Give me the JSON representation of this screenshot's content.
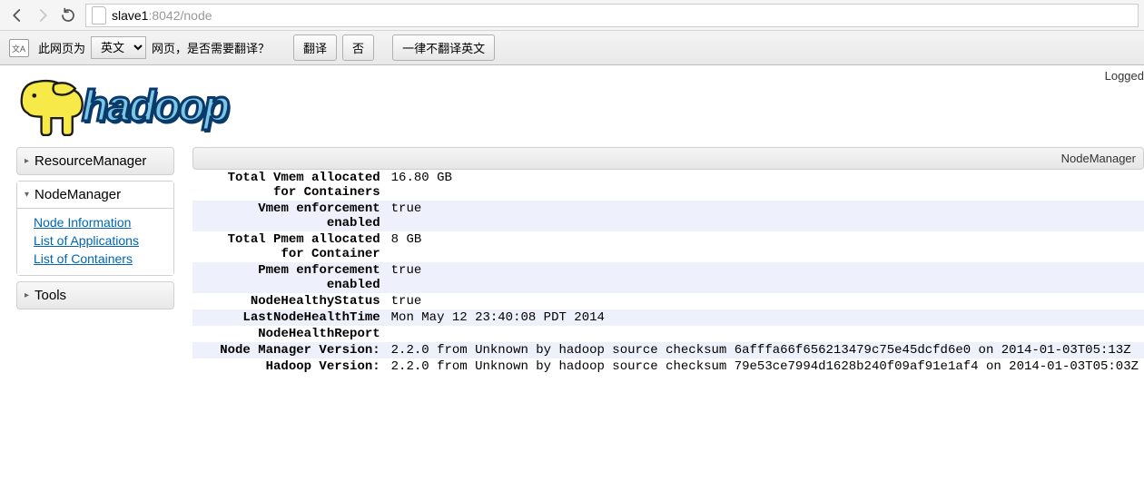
{
  "chrome": {
    "url_host": "slave1",
    "url_rest": ":8042/node"
  },
  "translate": {
    "prefix": "此网页为",
    "lang": "英文",
    "question": "网页，是否需要翻译？",
    "btn_translate": "翻译",
    "btn_no": "否",
    "btn_never": "一律不翻译英文"
  },
  "page": {
    "logged": "Logged",
    "logo_text": "hadoop",
    "panel_title": "NodeManager"
  },
  "sidebar": {
    "sections": [
      {
        "label": "ResourceManager",
        "expanded": false,
        "items": []
      },
      {
        "label": "NodeManager",
        "expanded": true,
        "items": [
          "Node Information",
          "List of Applications",
          "List of Containers"
        ]
      },
      {
        "label": "Tools",
        "expanded": false,
        "items": []
      }
    ]
  },
  "rows": [
    {
      "key": "Total Vmem allocated for Containers",
      "val": "16.80 GB"
    },
    {
      "key": "Vmem enforcement enabled",
      "val": "true"
    },
    {
      "key": "Total Pmem allocated for Container",
      "val": "8 GB"
    },
    {
      "key": "Pmem enforcement enabled",
      "val": "true"
    },
    {
      "key": "NodeHealthyStatus",
      "val": "true"
    },
    {
      "key": "LastNodeHealthTime",
      "val": "Mon May 12 23:40:08 PDT 2014"
    },
    {
      "key": "NodeHealthReport",
      "val": ""
    },
    {
      "key": "Node Manager Version:",
      "val": "2.2.0 from Unknown by hadoop source checksum 6afffa66f656213479c75e45dcfd6e0 on 2014-01-03T05:13Z"
    },
    {
      "key": "Hadoop Version:",
      "val": "2.2.0 from Unknown by hadoop source checksum 79e53ce7994d1628b240f09af91e1af4 on 2014-01-03T05:03Z"
    }
  ]
}
